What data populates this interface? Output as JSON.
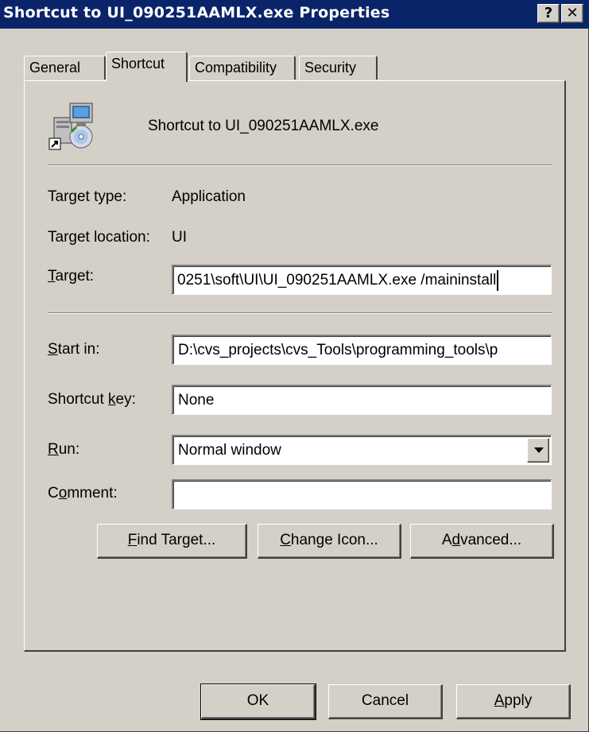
{
  "window": {
    "title": "Shortcut to UI_090251AAMLX.exe Properties",
    "help_button": "?",
    "close_button": "✕"
  },
  "tabs": [
    {
      "label": "General",
      "active": false
    },
    {
      "label": "Shortcut",
      "active": true
    },
    {
      "label": "Compatibility",
      "active": false
    },
    {
      "label": "Security",
      "active": false
    }
  ],
  "header": {
    "icon": "installer-shortcut-icon",
    "name": "Shortcut to UI_090251AAMLX.exe"
  },
  "info": {
    "target_type_label": "Target type:",
    "target_type_value": "Application",
    "target_location_label": "Target location:",
    "target_location_value": "UI"
  },
  "fields": {
    "target": {
      "label_pre": "",
      "label_key": "T",
      "label_post": "arget:",
      "value": "0251\\soft\\UI\\UI_090251AAMLX.exe /maininstall"
    },
    "start_in": {
      "label_pre": "",
      "label_key": "S",
      "label_post": "tart in:",
      "value": "D:\\cvs_projects\\cvs_Tools\\programming_tools\\p"
    },
    "shortcut_key": {
      "label_pre": "Shortcut ",
      "label_key": "k",
      "label_post": "ey:",
      "value": "None"
    },
    "run": {
      "label_pre": "",
      "label_key": "R",
      "label_post": "un:",
      "value": "Normal window"
    },
    "comment": {
      "label_pre": "C",
      "label_key": "o",
      "label_post": "mment:",
      "value": ""
    }
  },
  "action_buttons": {
    "find_target": {
      "pre": "",
      "key": "F",
      "post": "ind Target..."
    },
    "change_icon": {
      "pre": "",
      "key": "C",
      "post": "hange Icon..."
    },
    "advanced": {
      "pre": "A",
      "key": "d",
      "post": "vanced..."
    }
  },
  "footer_buttons": {
    "ok": "OK",
    "cancel": "Cancel",
    "apply": {
      "pre": "",
      "key": "A",
      "post": "pply"
    }
  },
  "colors": {
    "titlebar": "#0a246a",
    "face": "#d4d0c8",
    "field": "#ffffff"
  }
}
